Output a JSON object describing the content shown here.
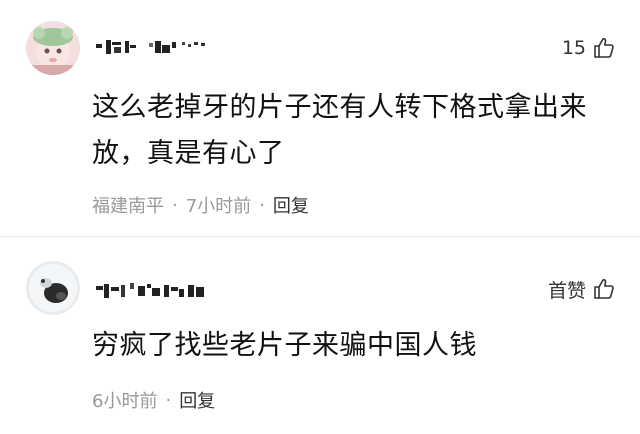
{
  "comments": [
    {
      "avatar_icon": "user-avatar-photo",
      "like_count": "15",
      "like_icon": "thumbs-up-icon",
      "text": "这么老掉牙的片子还有人转下格式拿出来放，真是有心了",
      "location": "福建南平",
      "separator": "·",
      "time": "7小时前",
      "reply_label": "回复"
    },
    {
      "avatar_icon": "user-avatar-photo",
      "like_label": "首赞",
      "like_icon": "thumbs-up-icon",
      "text": "穷疯了找些老片子来骗中国人钱",
      "time": "6小时前",
      "separator": "·",
      "reply_label": "回复"
    }
  ],
  "colors": {
    "text": "#111111",
    "meta": "#999999",
    "reply": "#333333",
    "divider": "#ededed"
  }
}
